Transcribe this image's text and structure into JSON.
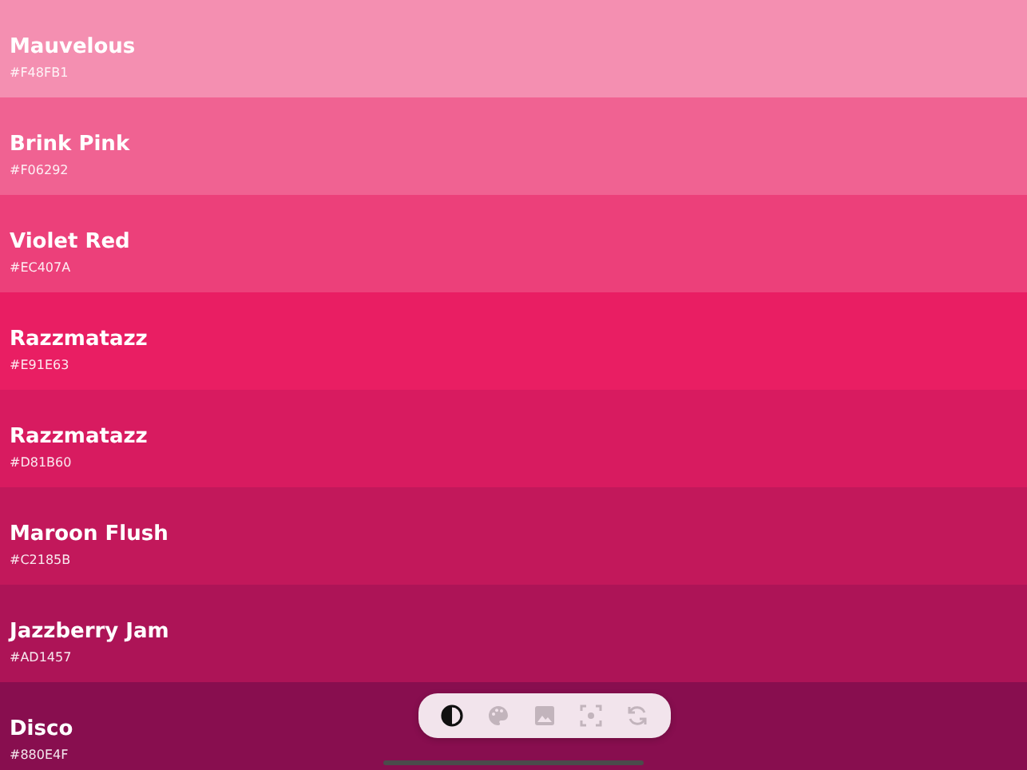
{
  "swatches": [
    {
      "name": "Mauvelous",
      "hex": "#F48FB1",
      "color": "#f48fb1"
    },
    {
      "name": "Brink Pink",
      "hex": "#F06292",
      "color": "#f06292"
    },
    {
      "name": "Violet Red",
      "hex": "#EC407A",
      "color": "#ec407a"
    },
    {
      "name": "Razzmatazz",
      "hex": "#E91E63",
      "color": "#e91e63"
    },
    {
      "name": "Razzmatazz",
      "hex": "#D81B60",
      "color": "#d81b60"
    },
    {
      "name": "Maroon Flush",
      "hex": "#C2185B",
      "color": "#c2185b"
    },
    {
      "name": "Jazzberry Jam",
      "hex": "#AD1457",
      "color": "#ad1457"
    },
    {
      "name": "Disco",
      "hex": "#880E4F",
      "color": "#880e4f"
    }
  ],
  "toolbar": [
    {
      "kind": "contrast",
      "selected": true
    },
    {
      "kind": "palette",
      "selected": false
    },
    {
      "kind": "image",
      "selected": false
    },
    {
      "kind": "focus",
      "selected": false
    },
    {
      "kind": "refresh",
      "selected": false
    }
  ]
}
